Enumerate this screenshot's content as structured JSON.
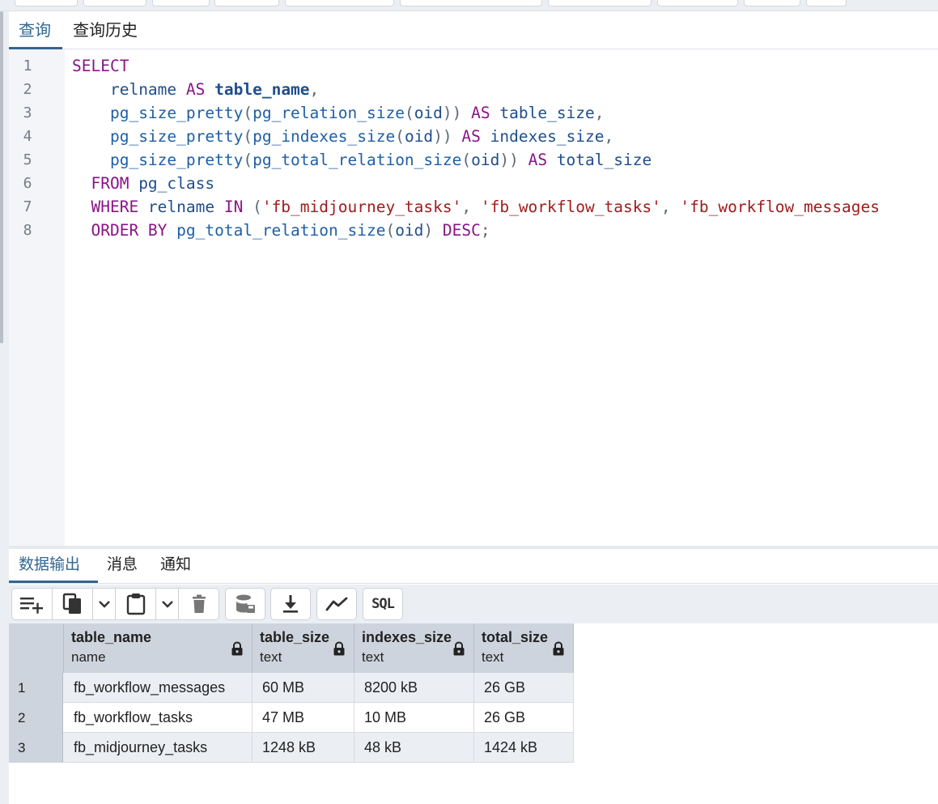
{
  "query_tabs": [
    {
      "label": "查询",
      "active": true
    },
    {
      "label": "查询历史",
      "active": false
    }
  ],
  "editor": {
    "line_numbers": [
      "1",
      "2",
      "3",
      "4",
      "5",
      "6",
      "7",
      "8"
    ],
    "lines": [
      [
        {
          "t": "SELECT",
          "c": "kw"
        }
      ],
      [
        {
          "t": "    ",
          "c": "id"
        },
        {
          "t": "relname",
          "c": "id"
        },
        {
          "t": " ",
          "c": "id"
        },
        {
          "t": "AS",
          "c": "kw"
        },
        {
          "t": " ",
          "c": "id"
        },
        {
          "t": "table_name",
          "c": "idb"
        },
        {
          "t": ",",
          "c": "pn"
        }
      ],
      [
        {
          "t": "    ",
          "c": "id"
        },
        {
          "t": "pg_size_pretty",
          "c": "fn"
        },
        {
          "t": "(",
          "c": "pn"
        },
        {
          "t": "pg_relation_size",
          "c": "fn"
        },
        {
          "t": "(",
          "c": "pn"
        },
        {
          "t": "oid",
          "c": "id"
        },
        {
          "t": "))",
          "c": "pn"
        },
        {
          "t": " ",
          "c": "id"
        },
        {
          "t": "AS",
          "c": "kw"
        },
        {
          "t": " table_size",
          "c": "id"
        },
        {
          "t": ",",
          "c": "pn"
        }
      ],
      [
        {
          "t": "    ",
          "c": "id"
        },
        {
          "t": "pg_size_pretty",
          "c": "fn"
        },
        {
          "t": "(",
          "c": "pn"
        },
        {
          "t": "pg_indexes_size",
          "c": "fn"
        },
        {
          "t": "(",
          "c": "pn"
        },
        {
          "t": "oid",
          "c": "id"
        },
        {
          "t": "))",
          "c": "pn"
        },
        {
          "t": " ",
          "c": "id"
        },
        {
          "t": "AS",
          "c": "kw"
        },
        {
          "t": " indexes_size",
          "c": "id"
        },
        {
          "t": ",",
          "c": "pn"
        }
      ],
      [
        {
          "t": "    ",
          "c": "id"
        },
        {
          "t": "pg_size_pretty",
          "c": "fn"
        },
        {
          "t": "(",
          "c": "pn"
        },
        {
          "t": "pg_total_relation_size",
          "c": "fn"
        },
        {
          "t": "(",
          "c": "pn"
        },
        {
          "t": "oid",
          "c": "id"
        },
        {
          "t": "))",
          "c": "pn"
        },
        {
          "t": " ",
          "c": "id"
        },
        {
          "t": "AS",
          "c": "kw"
        },
        {
          "t": " total_size",
          "c": "id"
        }
      ],
      [
        {
          "t": "  ",
          "c": "id"
        },
        {
          "t": "FROM",
          "c": "kw"
        },
        {
          "t": " pg_class",
          "c": "id"
        }
      ],
      [
        {
          "t": "  ",
          "c": "id"
        },
        {
          "t": "WHERE",
          "c": "kw"
        },
        {
          "t": " relname ",
          "c": "id"
        },
        {
          "t": "IN",
          "c": "kw"
        },
        {
          "t": " (",
          "c": "pn"
        },
        {
          "t": "'fb_midjourney_tasks'",
          "c": "str"
        },
        {
          "t": ", ",
          "c": "pn"
        },
        {
          "t": "'fb_workflow_tasks'",
          "c": "str"
        },
        {
          "t": ", ",
          "c": "pn"
        },
        {
          "t": "'fb_workflow_messages",
          "c": "str"
        }
      ],
      [
        {
          "t": "  ",
          "c": "id"
        },
        {
          "t": "ORDER BY",
          "c": "kw"
        },
        {
          "t": " ",
          "c": "id"
        },
        {
          "t": "pg_total_relation_size",
          "c": "fn"
        },
        {
          "t": "(",
          "c": "pn"
        },
        {
          "t": "oid",
          "c": "id"
        },
        {
          "t": ") ",
          "c": "pn"
        },
        {
          "t": "DESC",
          "c": "kw"
        },
        {
          "t": ";",
          "c": "pn"
        }
      ]
    ]
  },
  "output_tabs": [
    {
      "label": "数据输出",
      "active": true
    },
    {
      "label": "消息",
      "active": false
    },
    {
      "label": "通知",
      "active": false
    }
  ],
  "toolbar": {
    "sql_label": "SQL"
  },
  "grid": {
    "columns": [
      {
        "name": "table_name",
        "type": "name"
      },
      {
        "name": "table_size",
        "type": "text"
      },
      {
        "name": "indexes_size",
        "type": "text"
      },
      {
        "name": "total_size",
        "type": "text"
      }
    ],
    "rows": [
      {
        "num": "1",
        "cells": [
          "fb_workflow_messages",
          "60 MB",
          "8200 kB",
          "26 GB"
        ]
      },
      {
        "num": "2",
        "cells": [
          "fb_workflow_tasks",
          "47 MB",
          "10 MB",
          "26 GB"
        ]
      },
      {
        "num": "3",
        "cells": [
          "fb_midjourney_tasks",
          "1248 kB",
          "48 kB",
          "1424 kB"
        ]
      }
    ]
  },
  "colors": {
    "accent": "#326690",
    "keyword": "#8a1488",
    "string": "#a11c1c",
    "identifier": "#1f4e8c"
  }
}
